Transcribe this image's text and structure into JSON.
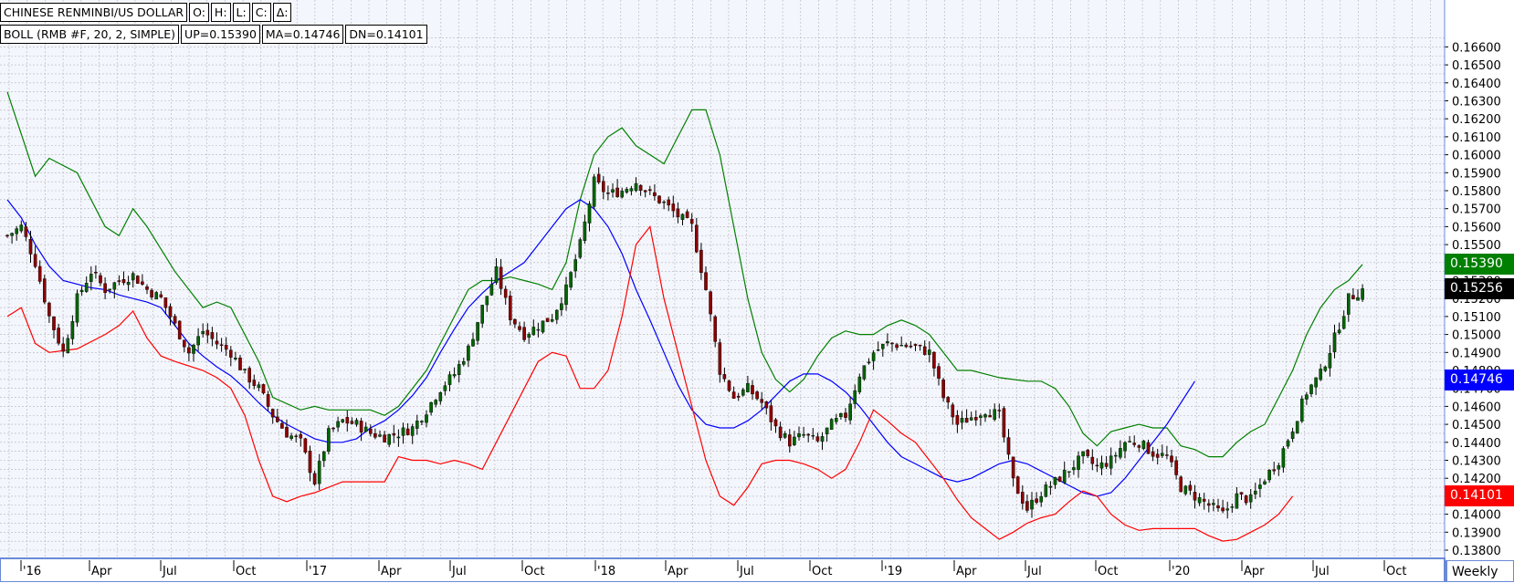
{
  "header": {
    "title": "CHINESE RENMINBI/US DOLLAR",
    "o_label": "O:",
    "h_label": "H:",
    "l_label": "L:",
    "c_label": "C:",
    "d_label": "Δ:",
    "boll_label": "BOLL (RMB #F, 20, 2, SIMPLE)",
    "up_label": "UP=0.15390",
    "ma_label": "MA=0.14746",
    "dn_label": "DN=0.14101"
  },
  "price_tags": {
    "upper": "0.15390",
    "last": "0.15256",
    "middle": "0.14746",
    "lower": "0.14101"
  },
  "period_label": "Weekly",
  "colors": {
    "up_candle": "#006400",
    "down_candle": "#8b0000",
    "upper_band": "#008000",
    "middle_band": "#0000ff",
    "lower_band": "#ff0000",
    "grid": "#b4b4b4",
    "plot_bg": "#f4f6fd",
    "axis_frame": "#6a8ad8"
  },
  "chart_data": {
    "type": "candlestick",
    "ylim": [
      0.1378,
      0.1662
    ],
    "y_ticks": [
      "0.16600",
      "0.16500",
      "0.16400",
      "0.16300",
      "0.16200",
      "0.16100",
      "0.16000",
      "0.15900",
      "0.15800",
      "0.15700",
      "0.15600",
      "0.15500",
      "0.15400",
      "0.15300",
      "0.15200",
      "0.15100",
      "0.15000",
      "0.14900",
      "0.14800",
      "0.14700",
      "0.14600",
      "0.14500",
      "0.14400",
      "0.14300",
      "0.14200",
      "0.14100",
      "0.14000",
      "0.13900",
      "0.13800"
    ],
    "x_ticks": [
      "'16",
      "Apr",
      "Jul",
      "Oct",
      "'17",
      "Apr",
      "Jul",
      "Oct",
      "'18",
      "Apr",
      "Jul",
      "Oct",
      "'19",
      "Apr",
      "Jul",
      "Oct",
      "'20",
      "Apr",
      "Jul",
      "Oct"
    ],
    "grid": true,
    "close_path": [
      [
        0,
        0.1555
      ],
      [
        3,
        0.156
      ],
      [
        6,
        0.154
      ],
      [
        9,
        0.151
      ],
      [
        12,
        0.149
      ],
      [
        15,
        0.152
      ],
      [
        18,
        0.1535
      ],
      [
        21,
        0.1525
      ],
      [
        24,
        0.153
      ],
      [
        27,
        0.1533
      ],
      [
        30,
        0.1525
      ],
      [
        33,
        0.152
      ],
      [
        36,
        0.1505
      ],
      [
        39,
        0.149
      ],
      [
        42,
        0.1502
      ],
      [
        45,
        0.1495
      ],
      [
        48,
        0.149
      ],
      [
        51,
        0.1478
      ],
      [
        54,
        0.147
      ],
      [
        57,
        0.1455
      ],
      [
        60,
        0.1445
      ],
      [
        63,
        0.144
      ],
      [
        66,
        0.1418
      ],
      [
        69,
        0.1445
      ],
      [
        72,
        0.1452
      ],
      [
        75,
        0.145
      ],
      [
        78,
        0.1445
      ],
      [
        81,
        0.1443
      ],
      [
        84,
        0.1445
      ],
      [
        87,
        0.1448
      ],
      [
        90,
        0.1458
      ],
      [
        93,
        0.147
      ],
      [
        96,
        0.1478
      ],
      [
        99,
        0.1492
      ],
      [
        102,
        0.1515
      ],
      [
        105,
        0.1535
      ],
      [
        108,
        0.151
      ],
      [
        111,
        0.15
      ],
      [
        114,
        0.1505
      ],
      [
        117,
        0.151
      ],
      [
        120,
        0.1525
      ],
      [
        123,
        0.155
      ],
      [
        126,
        0.1585
      ],
      [
        129,
        0.1578
      ],
      [
        132,
        0.158
      ],
      [
        135,
        0.1585
      ],
      [
        138,
        0.1578
      ],
      [
        141,
        0.1573
      ],
      [
        144,
        0.1566
      ],
      [
        147,
        0.156
      ],
      [
        150,
        0.1525
      ],
      [
        153,
        0.148
      ],
      [
        156,
        0.1465
      ],
      [
        159,
        0.147
      ],
      [
        162,
        0.1462
      ],
      [
        165,
        0.1448
      ],
      [
        168,
        0.144
      ],
      [
        171,
        0.1444
      ],
      [
        174,
        0.144
      ],
      [
        177,
        0.145
      ],
      [
        180,
        0.1455
      ],
      [
        183,
        0.1478
      ],
      [
        186,
        0.149
      ],
      [
        189,
        0.1495
      ],
      [
        192,
        0.1494
      ],
      [
        195,
        0.1493
      ],
      [
        198,
        0.149
      ],
      [
        201,
        0.1465
      ],
      [
        204,
        0.145
      ],
      [
        207,
        0.1454
      ],
      [
        210,
        0.1458
      ],
      [
        213,
        0.1455
      ],
      [
        216,
        0.1418
      ],
      [
        219,
        0.1403
      ],
      [
        222,
        0.1412
      ],
      [
        225,
        0.1418
      ],
      [
        228,
        0.1425
      ],
      [
        231,
        0.1432
      ],
      [
        234,
        0.1426
      ],
      [
        237,
        0.143
      ],
      [
        240,
        0.144
      ],
      [
        243,
        0.144
      ],
      [
        246,
        0.1434
      ],
      [
        249,
        0.1432
      ],
      [
        252,
        0.1415
      ],
      [
        255,
        0.141
      ],
      [
        258,
        0.1405
      ],
      [
        261,
        0.14
      ],
      [
        264,
        0.141
      ],
      [
        267,
        0.1408
      ],
      [
        270,
        0.142
      ],
      [
        273,
        0.143
      ],
      [
        276,
        0.1448
      ],
      [
        279,
        0.1468
      ],
      [
        282,
        0.1478
      ],
      [
        285,
        0.1498
      ],
      [
        288,
        0.152
      ],
      [
        291,
        0.1525
      ]
    ],
    "upper_band": [
      [
        0,
        0.1635
      ],
      [
        6,
        0.1588
      ],
      [
        9,
        0.1598
      ],
      [
        15,
        0.159
      ],
      [
        21,
        0.156
      ],
      [
        24,
        0.1555
      ],
      [
        27,
        0.157
      ],
      [
        30,
        0.156
      ],
      [
        36,
        0.1535
      ],
      [
        42,
        0.1515
      ],
      [
        45,
        0.1518
      ],
      [
        48,
        0.1515
      ],
      [
        51,
        0.15
      ],
      [
        54,
        0.1485
      ],
      [
        57,
        0.1465
      ],
      [
        63,
        0.1458
      ],
      [
        66,
        0.146
      ],
      [
        69,
        0.1458
      ],
      [
        72,
        0.1458
      ],
      [
        75,
        0.1458
      ],
      [
        78,
        0.1458
      ],
      [
        81,
        0.1455
      ],
      [
        84,
        0.146
      ],
      [
        87,
        0.147
      ],
      [
        90,
        0.148
      ],
      [
        93,
        0.1495
      ],
      [
        96,
        0.151
      ],
      [
        99,
        0.1525
      ],
      [
        102,
        0.153
      ],
      [
        105,
        0.153
      ],
      [
        108,
        0.1532
      ],
      [
        111,
        0.153
      ],
      [
        114,
        0.1528
      ],
      [
        117,
        0.1525
      ],
      [
        120,
        0.154
      ],
      [
        123,
        0.1575
      ],
      [
        126,
        0.16
      ],
      [
        129,
        0.161
      ],
      [
        132,
        0.1615
      ],
      [
        135,
        0.1605
      ],
      [
        138,
        0.16
      ],
      [
        141,
        0.1595
      ],
      [
        144,
        0.161
      ],
      [
        147,
        0.1625
      ],
      [
        150,
        0.1625
      ],
      [
        153,
        0.16
      ],
      [
        156,
        0.156
      ],
      [
        159,
        0.152
      ],
      [
        162,
        0.149
      ],
      [
        165,
        0.1475
      ],
      [
        168,
        0.1468
      ],
      [
        171,
        0.1475
      ],
      [
        174,
        0.1488
      ],
      [
        177,
        0.1498
      ],
      [
        180,
        0.1502
      ],
      [
        183,
        0.15
      ],
      [
        186,
        0.15
      ],
      [
        189,
        0.1505
      ],
      [
        192,
        0.1508
      ],
      [
        195,
        0.1505
      ],
      [
        198,
        0.15
      ],
      [
        201,
        0.149
      ],
      [
        204,
        0.148
      ],
      [
        207,
        0.148
      ],
      [
        210,
        0.1478
      ],
      [
        213,
        0.1476
      ],
      [
        216,
        0.1475
      ],
      [
        219,
        0.1474
      ],
      [
        222,
        0.1474
      ],
      [
        225,
        0.147
      ],
      [
        228,
        0.146
      ],
      [
        231,
        0.1445
      ],
      [
        234,
        0.1438
      ],
      [
        237,
        0.1446
      ],
      [
        240,
        0.1448
      ],
      [
        243,
        0.145
      ],
      [
        246,
        0.1448
      ],
      [
        249,
        0.1448
      ],
      [
        252,
        0.1438
      ],
      [
        255,
        0.1436
      ],
      [
        258,
        0.1432
      ],
      [
        261,
        0.1432
      ],
      [
        264,
        0.144
      ],
      [
        267,
        0.1446
      ],
      [
        270,
        0.145
      ],
      [
        273,
        0.1465
      ],
      [
        276,
        0.148
      ],
      [
        279,
        0.15
      ],
      [
        282,
        0.1515
      ],
      [
        285,
        0.1525
      ],
      [
        288,
        0.153
      ],
      [
        291,
        0.1539
      ]
    ],
    "middle_band": [
      [
        0,
        0.1575
      ],
      [
        3,
        0.1565
      ],
      [
        6,
        0.155
      ],
      [
        9,
        0.1538
      ],
      [
        12,
        0.153
      ],
      [
        15,
        0.1528
      ],
      [
        18,
        0.1526
      ],
      [
        21,
        0.1525
      ],
      [
        24,
        0.1522
      ],
      [
        27,
        0.152
      ],
      [
        30,
        0.1518
      ],
      [
        33,
        0.1515
      ],
      [
        36,
        0.1505
      ],
      [
        39,
        0.1495
      ],
      [
        42,
        0.1488
      ],
      [
        45,
        0.1482
      ],
      [
        48,
        0.1477
      ],
      [
        51,
        0.147
      ],
      [
        54,
        0.1462
      ],
      [
        57,
        0.1455
      ],
      [
        60,
        0.145
      ],
      [
        63,
        0.1446
      ],
      [
        66,
        0.1442
      ],
      [
        69,
        0.144
      ],
      [
        72,
        0.144
      ],
      [
        75,
        0.1442
      ],
      [
        78,
        0.1448
      ],
      [
        81,
        0.1452
      ],
      [
        84,
        0.1458
      ],
      [
        87,
        0.1466
      ],
      [
        90,
        0.1476
      ],
      [
        93,
        0.149
      ],
      [
        96,
        0.1503
      ],
      [
        99,
        0.1515
      ],
      [
        102,
        0.1523
      ],
      [
        105,
        0.153
      ],
      [
        108,
        0.1535
      ],
      [
        111,
        0.154
      ],
      [
        114,
        0.155
      ],
      [
        117,
        0.156
      ],
      [
        120,
        0.157
      ],
      [
        123,
        0.1575
      ],
      [
        126,
        0.157
      ],
      [
        129,
        0.156
      ],
      [
        132,
        0.1545
      ],
      [
        135,
        0.1525
      ],
      [
        138,
        0.1508
      ],
      [
        141,
        0.149
      ],
      [
        144,
        0.1472
      ],
      [
        147,
        0.1458
      ],
      [
        150,
        0.145
      ],
      [
        153,
        0.1448
      ],
      [
        156,
        0.1448
      ],
      [
        159,
        0.1452
      ],
      [
        162,
        0.1458
      ],
      [
        165,
        0.1466
      ],
      [
        168,
        0.1474
      ],
      [
        171,
        0.1478
      ],
      [
        174,
        0.1478
      ],
      [
        177,
        0.1474
      ],
      [
        180,
        0.1468
      ],
      [
        183,
        0.146
      ],
      [
        186,
        0.145
      ],
      [
        189,
        0.144
      ],
      [
        192,
        0.1432
      ],
      [
        195,
        0.1428
      ],
      [
        198,
        0.1424
      ],
      [
        201,
        0.142
      ],
      [
        204,
        0.1418
      ],
      [
        207,
        0.142
      ],
      [
        210,
        0.1424
      ],
      [
        213,
        0.1428
      ],
      [
        216,
        0.143
      ],
      [
        219,
        0.1428
      ],
      [
        222,
        0.1424
      ],
      [
        225,
        0.142
      ],
      [
        228,
        0.1416
      ],
      [
        231,
        0.1412
      ],
      [
        234,
        0.141
      ],
      [
        237,
        0.1412
      ],
      [
        240,
        0.142
      ],
      [
        243,
        0.143
      ],
      [
        246,
        0.144
      ],
      [
        249,
        0.145
      ],
      [
        252,
        0.1462
      ],
      [
        255,
        0.1474
      ]
    ],
    "lower_band": [
      [
        0,
        0.151
      ],
      [
        3,
        0.1515
      ],
      [
        6,
        0.1495
      ],
      [
        9,
        0.149
      ],
      [
        15,
        0.1492
      ],
      [
        21,
        0.15
      ],
      [
        24,
        0.1505
      ],
      [
        27,
        0.1513
      ],
      [
        30,
        0.1498
      ],
      [
        33,
        0.1488
      ],
      [
        36,
        0.1485
      ],
      [
        42,
        0.148
      ],
      [
        45,
        0.1476
      ],
      [
        48,
        0.147
      ],
      [
        51,
        0.1455
      ],
      [
        54,
        0.143
      ],
      [
        57,
        0.141
      ],
      [
        60,
        0.1407
      ],
      [
        63,
        0.141
      ],
      [
        66,
        0.1412
      ],
      [
        69,
        0.1415
      ],
      [
        72,
        0.1418
      ],
      [
        75,
        0.1418
      ],
      [
        78,
        0.1418
      ],
      [
        81,
        0.1418
      ],
      [
        84,
        0.1432
      ],
      [
        87,
        0.143
      ],
      [
        90,
        0.143
      ],
      [
        93,
        0.1428
      ],
      [
        96,
        0.143
      ],
      [
        99,
        0.1428
      ],
      [
        102,
        0.1425
      ],
      [
        105,
        0.144
      ],
      [
        108,
        0.1455
      ],
      [
        111,
        0.147
      ],
      [
        114,
        0.1485
      ],
      [
        117,
        0.149
      ],
      [
        120,
        0.1488
      ],
      [
        123,
        0.147
      ],
      [
        126,
        0.147
      ],
      [
        129,
        0.148
      ],
      [
        132,
        0.151
      ],
      [
        135,
        0.155
      ],
      [
        138,
        0.156
      ],
      [
        141,
        0.152
      ],
      [
        144,
        0.149
      ],
      [
        147,
        0.146
      ],
      [
        150,
        0.143
      ],
      [
        153,
        0.141
      ],
      [
        156,
        0.1405
      ],
      [
        159,
        0.1415
      ],
      [
        162,
        0.1428
      ],
      [
        165,
        0.143
      ],
      [
        168,
        0.143
      ],
      [
        171,
        0.1428
      ],
      [
        174,
        0.1425
      ],
      [
        177,
        0.142
      ],
      [
        180,
        0.1425
      ],
      [
        183,
        0.144
      ],
      [
        186,
        0.1458
      ],
      [
        189,
        0.1452
      ],
      [
        192,
        0.1445
      ],
      [
        195,
        0.144
      ],
      [
        198,
        0.143
      ],
      [
        201,
        0.142
      ],
      [
        204,
        0.1408
      ],
      [
        207,
        0.1398
      ],
      [
        210,
        0.1392
      ],
      [
        213,
        0.1386
      ],
      [
        216,
        0.139
      ],
      [
        219,
        0.1395
      ],
      [
        222,
        0.1398
      ],
      [
        225,
        0.14
      ],
      [
        228,
        0.1407
      ],
      [
        231,
        0.1413
      ],
      [
        234,
        0.141
      ],
      [
        237,
        0.14
      ],
      [
        240,
        0.1394
      ],
      [
        243,
        0.1391
      ],
      [
        246,
        0.1392
      ],
      [
        249,
        0.1392
      ],
      [
        252,
        0.1392
      ],
      [
        255,
        0.1392
      ],
      [
        258,
        0.1388
      ],
      [
        261,
        0.1385
      ],
      [
        264,
        0.1386
      ],
      [
        267,
        0.139
      ],
      [
        270,
        0.1394
      ],
      [
        273,
        0.14
      ],
      [
        276,
        0.141
      ]
    ],
    "upper_value": 0.1539,
    "last_value": 0.15256,
    "middle_value": 0.14746,
    "lower_value": 0.14101
  }
}
